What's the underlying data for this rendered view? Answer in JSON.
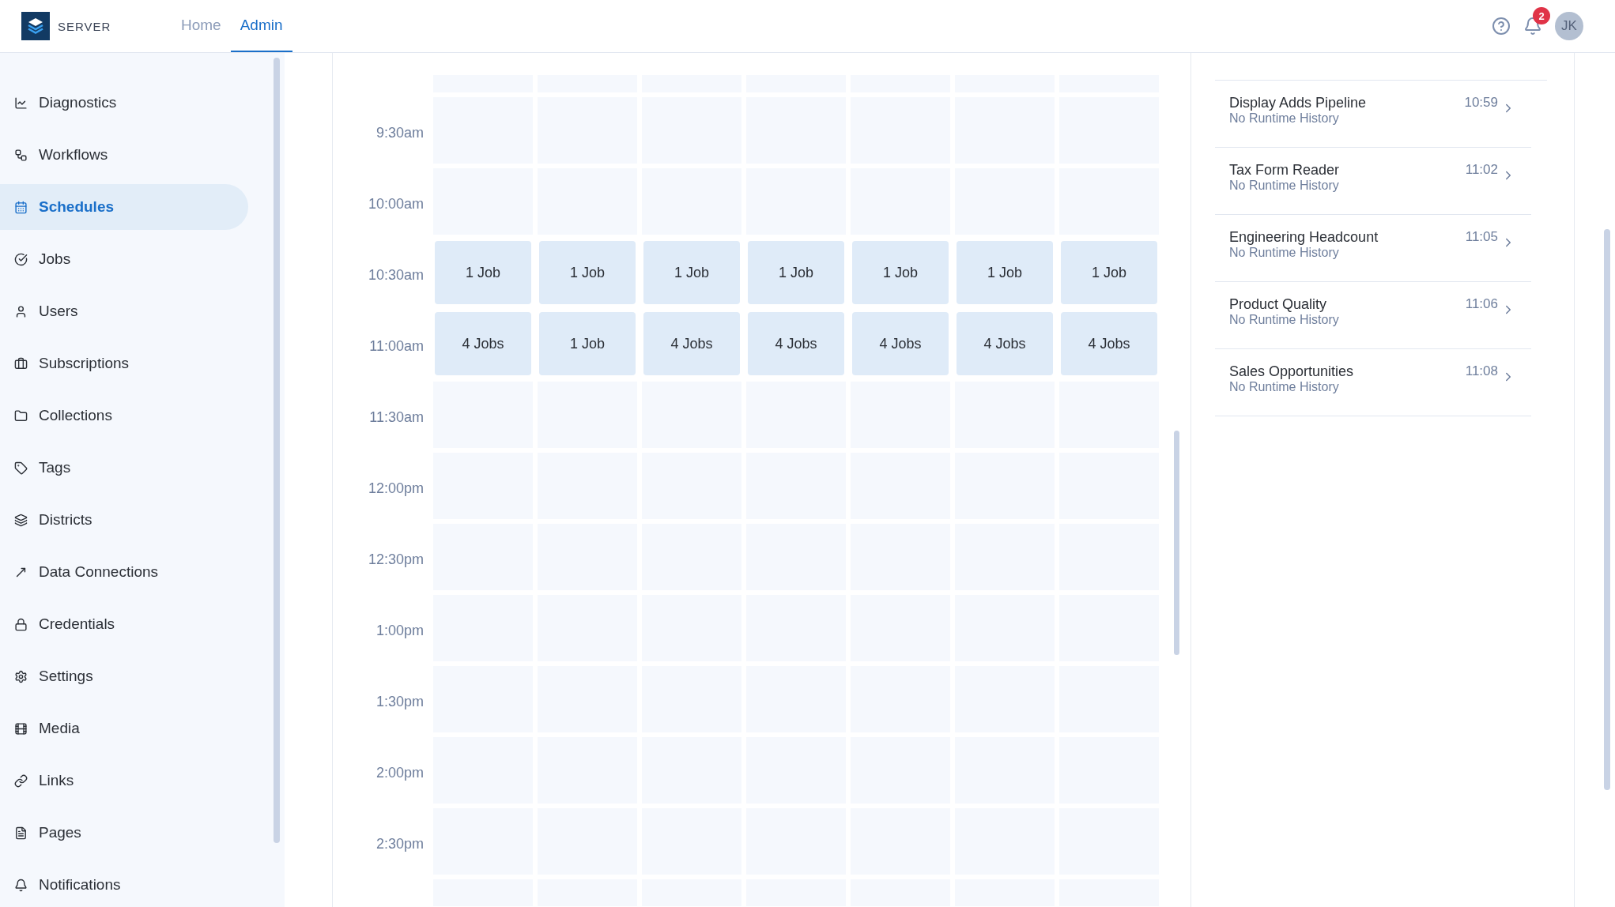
{
  "header": {
    "brand": "SERVER",
    "tabs": [
      {
        "label": "Home",
        "selected": false
      },
      {
        "label": "Admin",
        "selected": true
      }
    ],
    "notification_count": "2",
    "avatar": "JK"
  },
  "sidebar": {
    "items": [
      {
        "label": "Diagnostics",
        "selected": false
      },
      {
        "label": "Workflows",
        "selected": false
      },
      {
        "label": "Schedules",
        "selected": true
      },
      {
        "label": "Jobs",
        "selected": false
      },
      {
        "label": "Users",
        "selected": false
      },
      {
        "label": "Subscriptions",
        "selected": false
      },
      {
        "label": "Collections",
        "selected": false
      },
      {
        "label": "Tags",
        "selected": false
      },
      {
        "label": "Districts",
        "selected": false
      },
      {
        "label": "Data Connections",
        "selected": false
      },
      {
        "label": "Credentials",
        "selected": false
      },
      {
        "label": "Settings",
        "selected": false
      },
      {
        "label": "Media",
        "selected": false
      },
      {
        "label": "Links",
        "selected": false
      },
      {
        "label": "Pages",
        "selected": false
      },
      {
        "label": "Notifications",
        "selected": false
      }
    ]
  },
  "calendar": {
    "rows": [
      {
        "time": "9:30am"
      },
      {
        "time": "10:00am"
      },
      {
        "time": "10:30am",
        "jobs": [
          "1 Job",
          "1 Job",
          "1 Job",
          "1 Job",
          "1 Job",
          "1 Job",
          "1 Job"
        ]
      },
      {
        "time": "11:00am",
        "jobs": [
          "4 Jobs",
          "1 Job",
          "4 Jobs",
          "4 Jobs",
          "4 Jobs",
          "4 Jobs",
          "4 Jobs"
        ]
      },
      {
        "time": "11:30am"
      },
      {
        "time": "12:00pm"
      },
      {
        "time": "12:30pm"
      },
      {
        "time": "1:00pm"
      },
      {
        "time": "1:30pm"
      },
      {
        "time": "2:00pm"
      },
      {
        "time": "2:30pm"
      }
    ]
  },
  "schedule_list": [
    {
      "name": "Display Adds Pipeline",
      "status": "No Runtime History",
      "time": "10:59"
    },
    {
      "name": "Tax Form Reader",
      "status": "No Runtime History",
      "time": "11:02"
    },
    {
      "name": "Engineering Headcount",
      "status": "No Runtime History",
      "time": "11:05"
    },
    {
      "name": "Product Quality",
      "status": "No Runtime History",
      "time": "11:06"
    },
    {
      "name": "Sales Opportunities",
      "status": "No Runtime History",
      "time": "11:08"
    }
  ]
}
